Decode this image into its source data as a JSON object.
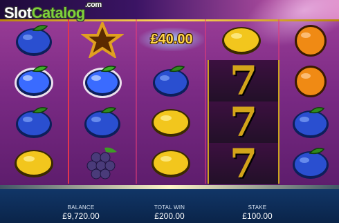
{
  "brand": {
    "logo_slot": "Slot",
    "logo_catalog": "Catalog",
    "logo_com": ".com"
  },
  "win": {
    "amount": "£40.00"
  },
  "reels": [
    [
      "plum",
      "plum-glow",
      "plum",
      "lemon"
    ],
    [
      "star",
      "plum-glow",
      "plum",
      "grapes"
    ],
    [
      "win",
      "plum",
      "lemon",
      "lemon"
    ],
    [
      "lemon",
      "seven",
      "seven",
      "seven"
    ],
    [
      "orange",
      "orange",
      "plum",
      "plum"
    ]
  ],
  "footer": {
    "balance_label": "BALANCE",
    "balance_value": "£9,720.00",
    "total_win_label": "TOTAL WIN",
    "total_win_value": "£200.00",
    "stake_label": "STAKE",
    "stake_value": "£100.00"
  },
  "colors": {
    "plum": "#2a4fd0",
    "lemon": "#f2c61d",
    "orange": "#f08a14",
    "grapes": "#4a3b7a",
    "seven": "#d3a41a"
  }
}
